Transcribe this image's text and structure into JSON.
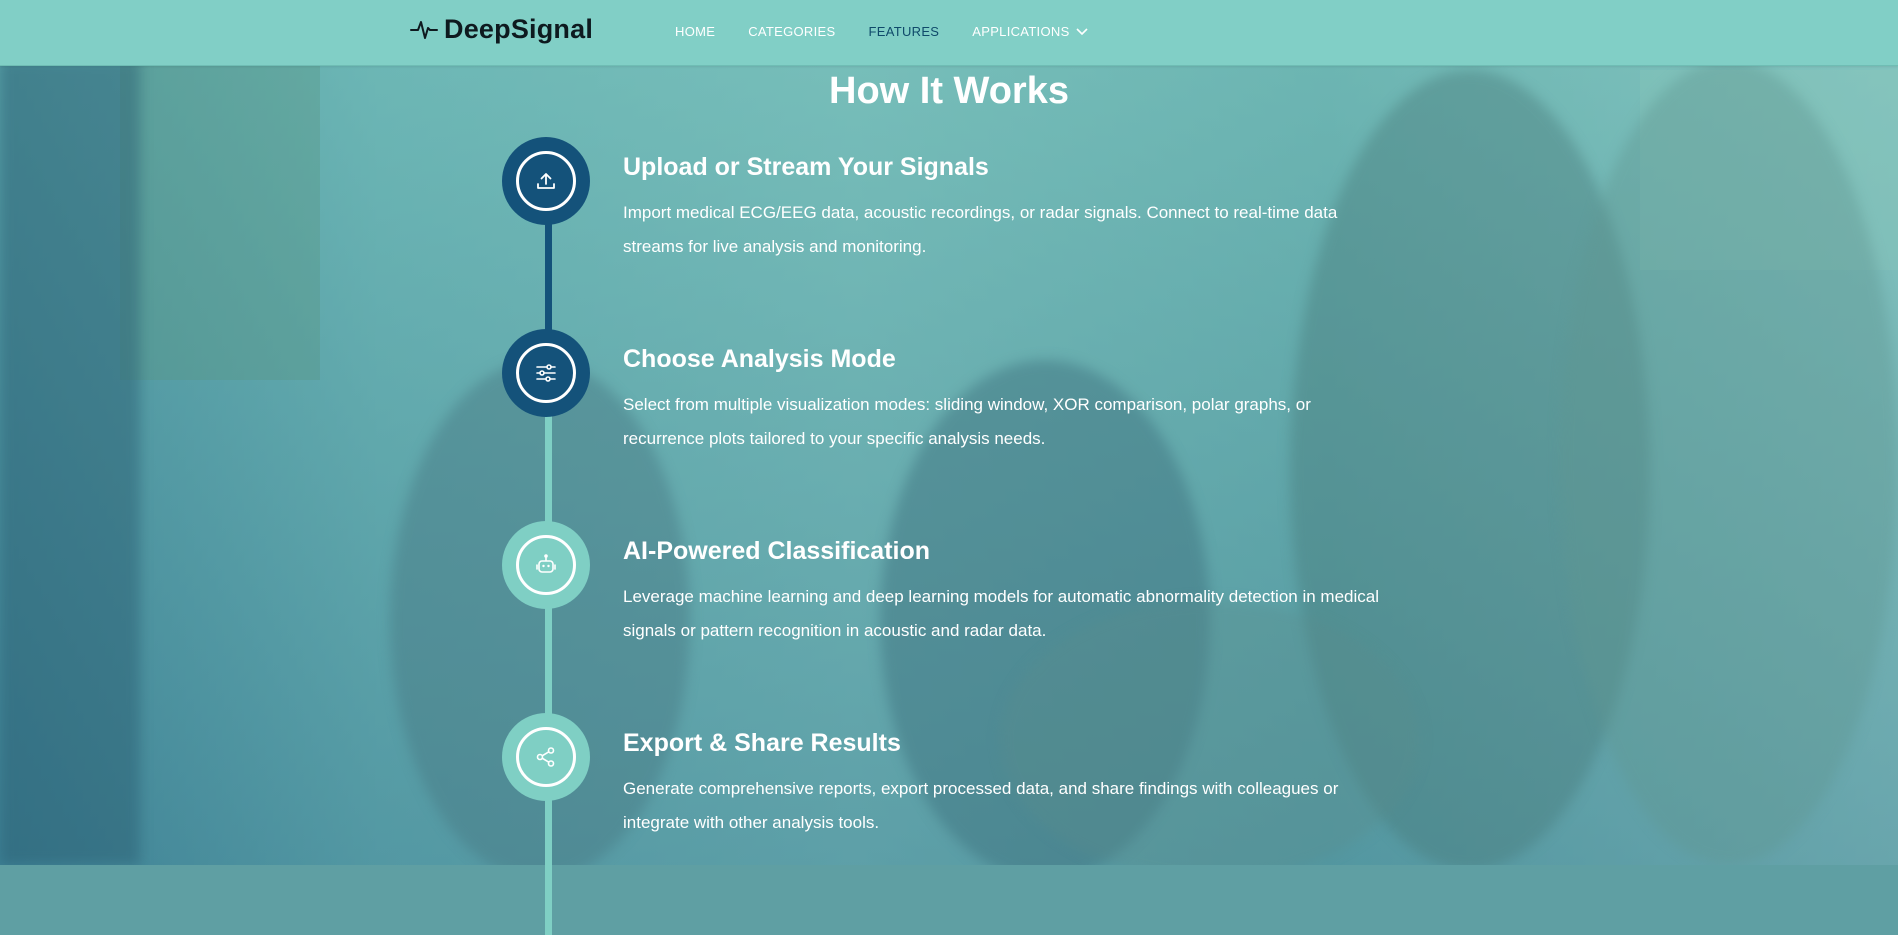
{
  "header": {
    "brand": "DeepSignal",
    "nav": [
      {
        "label": "HOME"
      },
      {
        "label": "CATEGORIES"
      },
      {
        "label": "FEATURES"
      },
      {
        "label": "APPLICATIONS"
      }
    ]
  },
  "section": {
    "title": "How It Works",
    "steps": [
      {
        "title": "Upload or Stream Your Signals",
        "description": "Import medical ECG/EEG data, acoustic recordings, or radar signals. Connect to real-time data streams for live analysis and monitoring.",
        "icon": "upload-icon"
      },
      {
        "title": "Choose Analysis Mode",
        "description": "Select from multiple visualization modes: sliding window, XOR comparison, polar graphs, or recurrence plots tailored to your specific analysis needs.",
        "icon": "sliders-icon"
      },
      {
        "title": "AI-Powered Classification",
        "description": "Leverage machine learning and deep learning models for automatic abnormality detection in medical signals or pattern recognition in acoustic and radar data.",
        "icon": "robot-icon"
      },
      {
        "title": "Export & Share Results",
        "description": "Generate comprehensive reports, export processed data, and share findings with colleagues or integrate with other analysis tools.",
        "icon": "share-icon"
      }
    ]
  },
  "colors": {
    "header_bg": "#81cfc6",
    "step_dark": "#14527a",
    "step_light": "#7fcfc4",
    "nav_active": "#0f4a6a"
  }
}
